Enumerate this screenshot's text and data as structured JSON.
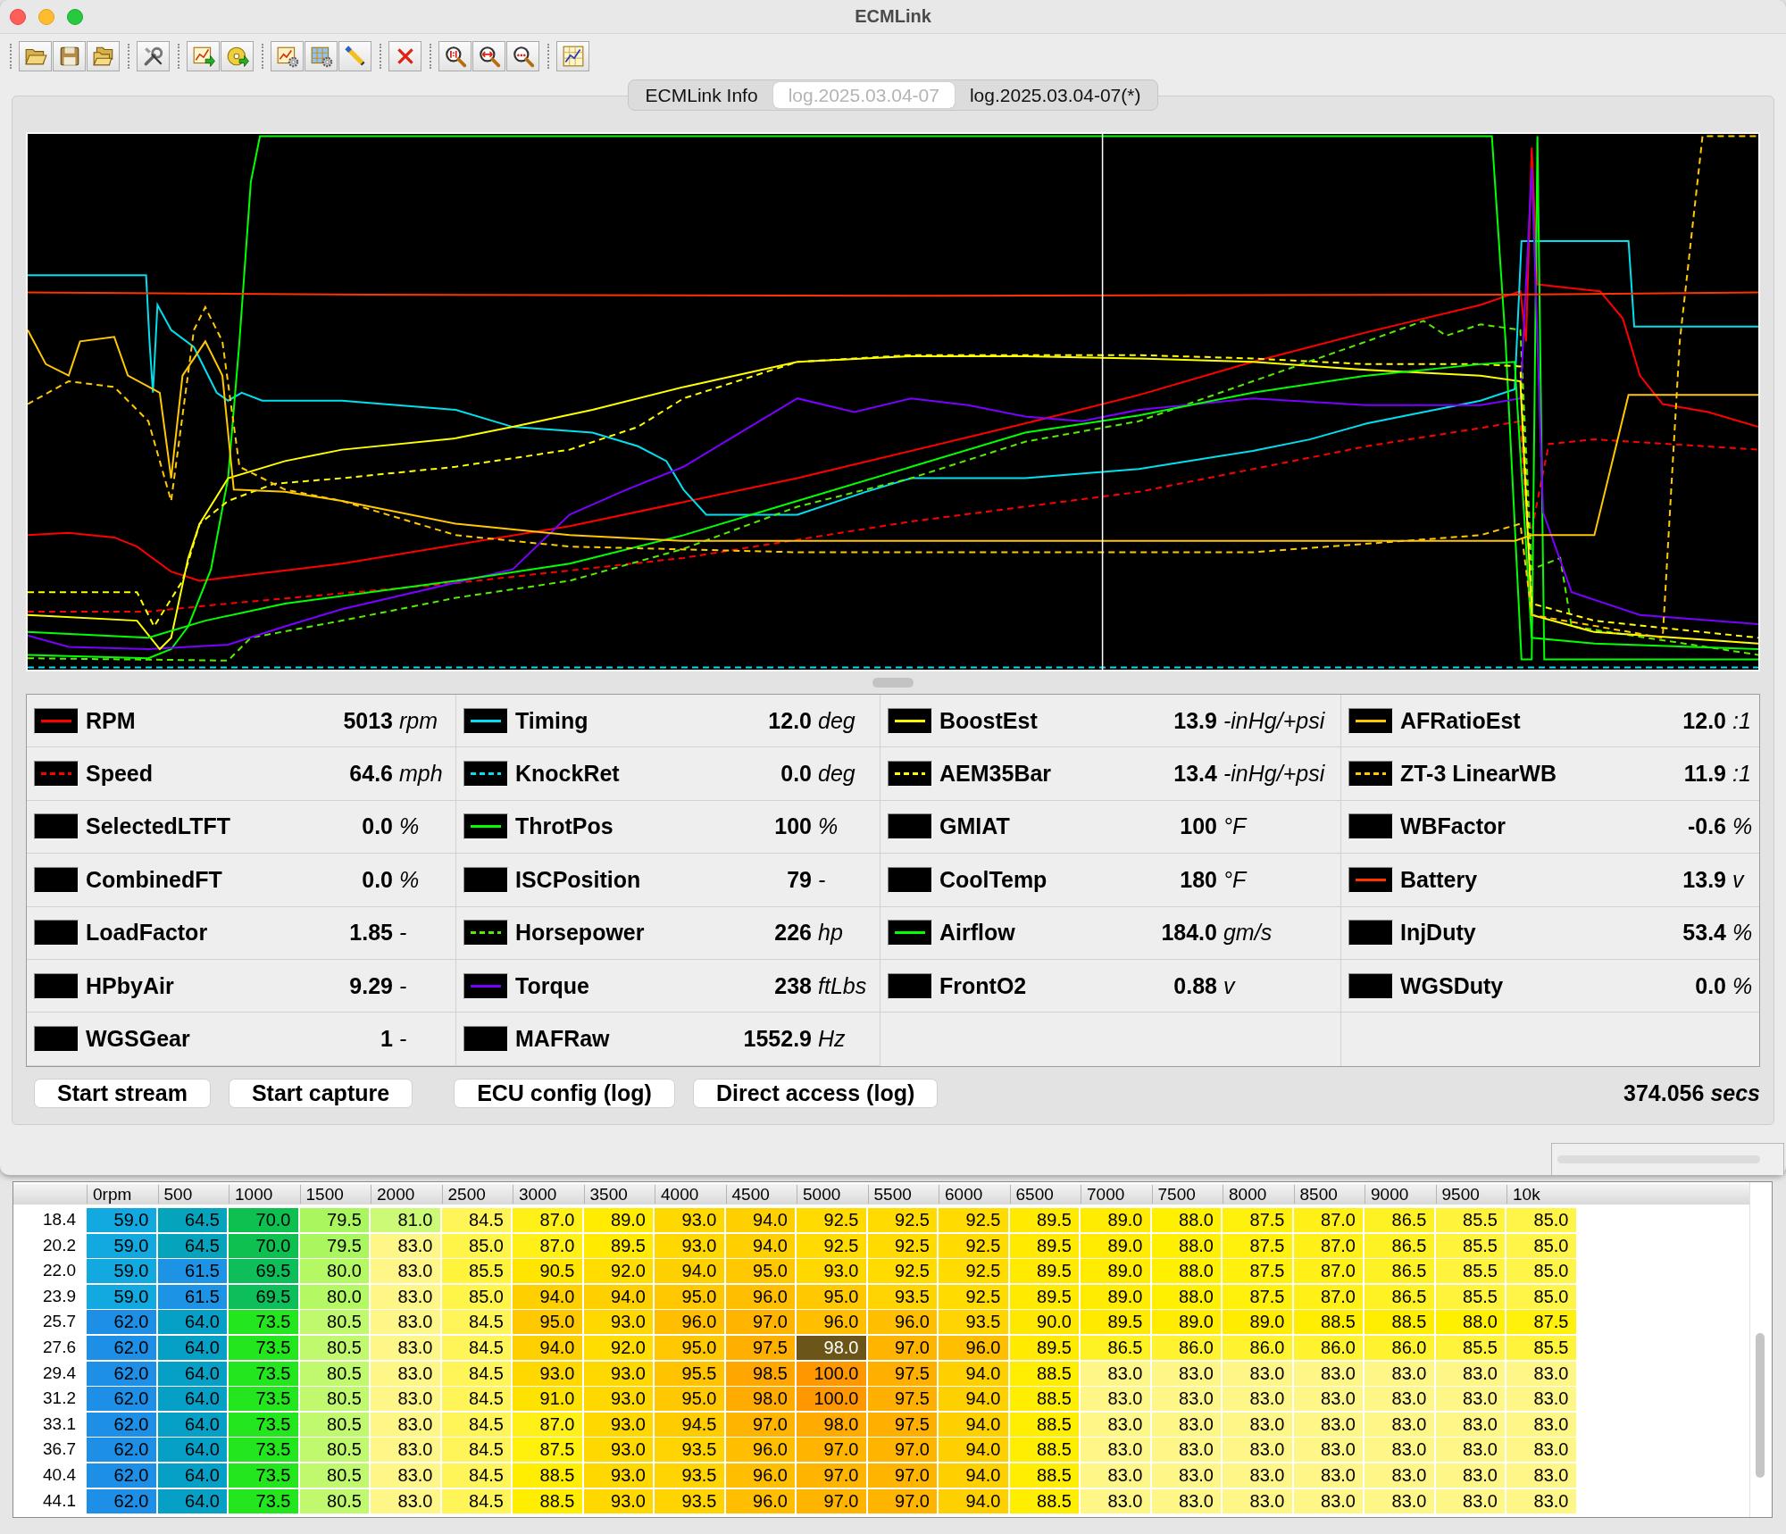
{
  "window": {
    "title": "ECMLink"
  },
  "tabs": [
    {
      "label": "ECMLink Info",
      "selected": false
    },
    {
      "label": "log.2025.03.04-07",
      "selected": true
    },
    {
      "label": "log.2025.03.04-07(*)",
      "selected": false
    }
  ],
  "gauge_columns": [
    {
      "gauges": [
        {
          "name": "RPM",
          "value": "5013",
          "unit": "rpm",
          "kind": "solid",
          "color": "#ff0000"
        },
        {
          "name": "Speed",
          "value": "64.6",
          "unit": "mph",
          "kind": "dashed",
          "color": "#ff0000"
        },
        {
          "name": "SelectedLTFT",
          "value": "0.0",
          "unit": "%",
          "kind": "empty"
        },
        {
          "name": "CombinedFT",
          "value": "0.0",
          "unit": "%",
          "kind": "empty"
        },
        {
          "name": "LoadFactor",
          "value": "1.85",
          "unit": "-",
          "kind": "empty"
        },
        {
          "name": "HPbyAir",
          "value": "9.29",
          "unit": "-",
          "kind": "empty"
        },
        {
          "name": "WGSGear",
          "value": "1",
          "unit": "-",
          "kind": "empty"
        }
      ]
    },
    {
      "gauges": [
        {
          "name": "Timing",
          "value": "12.0",
          "unit": "deg",
          "kind": "solid",
          "color": "#00e0f0"
        },
        {
          "name": "KnockRet",
          "value": "0.0",
          "unit": "deg",
          "kind": "dashed",
          "color": "#00e0f0"
        },
        {
          "name": "ThrotPos",
          "value": "100",
          "unit": "%",
          "kind": "solid",
          "color": "#00ff00"
        },
        {
          "name": "ISCPosition",
          "value": "79",
          "unit": "-",
          "kind": "empty"
        },
        {
          "name": "Horsepower",
          "value": "226",
          "unit": "hp",
          "kind": "dashed",
          "color": "#55ee00"
        },
        {
          "name": "Torque",
          "value": "238",
          "unit": "ftLbs",
          "kind": "solid",
          "color": "#7a00ff"
        },
        {
          "name": "MAFRaw",
          "value": "1552.9",
          "unit": "Hz",
          "kind": "empty"
        }
      ]
    },
    {
      "gauges": [
        {
          "name": "BoostEst",
          "value": "13.9",
          "unit": "-inHg/+psi",
          "kind": "solid",
          "color": "#ffff00"
        },
        {
          "name": "AEM35Bar",
          "value": "13.4",
          "unit": "-inHg/+psi",
          "kind": "dashed",
          "color": "#ffff00"
        },
        {
          "name": "GMIAT",
          "value": "100",
          "unit": "°F",
          "kind": "empty"
        },
        {
          "name": "CoolTemp",
          "value": "180",
          "unit": "°F",
          "kind": "empty"
        },
        {
          "name": "Airflow",
          "value": "184.0",
          "unit": "gm/s",
          "kind": "solid",
          "color": "#00ff00"
        },
        {
          "name": "FrontO2",
          "value": "0.88",
          "unit": "v",
          "kind": "empty"
        }
      ]
    },
    {
      "gauges": [
        {
          "name": "AFRatioEst",
          "value": "12.0",
          "unit": ":1",
          "kind": "solid",
          "color": "#ffc800"
        },
        {
          "name": "ZT-3 LinearWB",
          "value": "11.9",
          "unit": ":1",
          "kind": "dashed",
          "color": "#ffc800"
        },
        {
          "name": "WBFactor",
          "value": "-0.6",
          "unit": "%",
          "kind": "empty"
        },
        {
          "name": "Battery",
          "value": "13.9",
          "unit": "v",
          "kind": "solid",
          "color": "#ff3300"
        },
        {
          "name": "InjDuty",
          "value": "53.4",
          "unit": "%",
          "kind": "empty"
        },
        {
          "name": "WGSDuty",
          "value": "0.0",
          "unit": "%",
          "kind": "empty"
        }
      ]
    }
  ],
  "buttons": [
    "Start stream",
    "Start capture",
    "ECU config (log)",
    "Direct access (log)"
  ],
  "elapsed": {
    "value": "374.056",
    "unit": "secs"
  },
  "table": {
    "columns": [
      "0rpm",
      "500",
      "1000",
      "1500",
      "2000",
      "2500",
      "3000",
      "3500",
      "4000",
      "4500",
      "5000",
      "5500",
      "6000",
      "6500",
      "7000",
      "7500",
      "8000",
      "8500",
      "9000",
      "9500",
      "10k"
    ],
    "rows": [
      {
        "label": "18.4",
        "cells": [
          {
            "value": "59.0",
            "selected": false
          },
          {
            "value": "64.5",
            "selected": false
          },
          {
            "value": "70.0",
            "selected": false
          },
          {
            "value": "79.5",
            "selected": false
          },
          {
            "value": "81.0",
            "selected": false
          },
          {
            "value": "84.5",
            "selected": false
          },
          {
            "value": "87.0",
            "selected": false
          },
          {
            "value": "89.0",
            "selected": false
          },
          {
            "value": "93.0",
            "selected": false
          },
          {
            "value": "94.0",
            "selected": false
          },
          {
            "value": "92.5",
            "selected": false
          },
          {
            "value": "92.5",
            "selected": false
          },
          {
            "value": "92.5",
            "selected": false
          },
          {
            "value": "89.5",
            "selected": false
          },
          {
            "value": "89.0",
            "selected": false
          },
          {
            "value": "88.0",
            "selected": false
          },
          {
            "value": "87.5",
            "selected": false
          },
          {
            "value": "87.0",
            "selected": false
          },
          {
            "value": "86.5",
            "selected": false
          },
          {
            "value": "85.5",
            "selected": false
          },
          {
            "value": "85.0",
            "selected": false
          }
        ]
      },
      {
        "label": "20.2",
        "cells": [
          {
            "value": "59.0",
            "selected": false
          },
          {
            "value": "64.5",
            "selected": false
          },
          {
            "value": "70.0",
            "selected": false
          },
          {
            "value": "79.5",
            "selected": false
          },
          {
            "value": "83.0",
            "selected": false
          },
          {
            "value": "85.0",
            "selected": false
          },
          {
            "value": "87.0",
            "selected": false
          },
          {
            "value": "89.5",
            "selected": false
          },
          {
            "value": "93.0",
            "selected": false
          },
          {
            "value": "94.0",
            "selected": false
          },
          {
            "value": "92.5",
            "selected": false
          },
          {
            "value": "92.5",
            "selected": false
          },
          {
            "value": "92.5",
            "selected": false
          },
          {
            "value": "89.5",
            "selected": false
          },
          {
            "value": "89.0",
            "selected": false
          },
          {
            "value": "88.0",
            "selected": false
          },
          {
            "value": "87.5",
            "selected": false
          },
          {
            "value": "87.0",
            "selected": false
          },
          {
            "value": "86.5",
            "selected": false
          },
          {
            "value": "85.5",
            "selected": false
          },
          {
            "value": "85.0",
            "selected": false
          }
        ]
      },
      {
        "label": "22.0",
        "cells": [
          {
            "value": "59.0",
            "selected": false
          },
          {
            "value": "61.5",
            "selected": false
          },
          {
            "value": "69.5",
            "selected": false
          },
          {
            "value": "80.0",
            "selected": false
          },
          {
            "value": "83.0",
            "selected": false
          },
          {
            "value": "85.5",
            "selected": false
          },
          {
            "value": "90.5",
            "selected": false
          },
          {
            "value": "92.0",
            "selected": false
          },
          {
            "value": "94.0",
            "selected": false
          },
          {
            "value": "95.0",
            "selected": false
          },
          {
            "value": "93.0",
            "selected": false
          },
          {
            "value": "92.5",
            "selected": false
          },
          {
            "value": "92.5",
            "selected": false
          },
          {
            "value": "89.5",
            "selected": false
          },
          {
            "value": "89.0",
            "selected": false
          },
          {
            "value": "88.0",
            "selected": false
          },
          {
            "value": "87.5",
            "selected": false
          },
          {
            "value": "87.0",
            "selected": false
          },
          {
            "value": "86.5",
            "selected": false
          },
          {
            "value": "85.5",
            "selected": false
          },
          {
            "value": "85.0",
            "selected": false
          }
        ]
      },
      {
        "label": "23.9",
        "cells": [
          {
            "value": "59.0",
            "selected": false
          },
          {
            "value": "61.5",
            "selected": false
          },
          {
            "value": "69.5",
            "selected": false
          },
          {
            "value": "80.0",
            "selected": false
          },
          {
            "value": "83.0",
            "selected": false
          },
          {
            "value": "85.0",
            "selected": false
          },
          {
            "value": "94.0",
            "selected": false
          },
          {
            "value": "94.0",
            "selected": false
          },
          {
            "value": "95.0",
            "selected": false
          },
          {
            "value": "96.0",
            "selected": false
          },
          {
            "value": "95.0",
            "selected": false
          },
          {
            "value": "93.5",
            "selected": false
          },
          {
            "value": "92.5",
            "selected": false
          },
          {
            "value": "89.5",
            "selected": false
          },
          {
            "value": "89.0",
            "selected": false
          },
          {
            "value": "88.0",
            "selected": false
          },
          {
            "value": "87.5",
            "selected": false
          },
          {
            "value": "87.0",
            "selected": false
          },
          {
            "value": "86.5",
            "selected": false
          },
          {
            "value": "85.5",
            "selected": false
          },
          {
            "value": "85.0",
            "selected": false
          }
        ]
      },
      {
        "label": "25.7",
        "cells": [
          {
            "value": "62.0",
            "selected": false
          },
          {
            "value": "64.0",
            "selected": false
          },
          {
            "value": "73.5",
            "selected": false
          },
          {
            "value": "80.5",
            "selected": false
          },
          {
            "value": "83.0",
            "selected": false
          },
          {
            "value": "84.5",
            "selected": false
          },
          {
            "value": "95.0",
            "selected": false
          },
          {
            "value": "93.0",
            "selected": false
          },
          {
            "value": "96.0",
            "selected": false
          },
          {
            "value": "97.0",
            "selected": false
          },
          {
            "value": "96.0",
            "selected": false
          },
          {
            "value": "96.0",
            "selected": false
          },
          {
            "value": "93.5",
            "selected": false
          },
          {
            "value": "90.0",
            "selected": false
          },
          {
            "value": "89.5",
            "selected": false
          },
          {
            "value": "89.0",
            "selected": false
          },
          {
            "value": "89.0",
            "selected": false
          },
          {
            "value": "88.5",
            "selected": false
          },
          {
            "value": "88.5",
            "selected": false
          },
          {
            "value": "88.0",
            "selected": false
          },
          {
            "value": "87.5",
            "selected": false
          }
        ]
      },
      {
        "label": "27.6",
        "cells": [
          {
            "value": "62.0",
            "selected": false
          },
          {
            "value": "64.0",
            "selected": false
          },
          {
            "value": "73.5",
            "selected": false
          },
          {
            "value": "80.5",
            "selected": false
          },
          {
            "value": "83.0",
            "selected": false
          },
          {
            "value": "84.5",
            "selected": false
          },
          {
            "value": "94.0",
            "selected": false
          },
          {
            "value": "92.0",
            "selected": false
          },
          {
            "value": "95.0",
            "selected": false
          },
          {
            "value": "97.5",
            "selected": false
          },
          {
            "value": "98.0",
            "selected": true
          },
          {
            "value": "97.0",
            "selected": false
          },
          {
            "value": "96.0",
            "selected": false
          },
          {
            "value": "89.5",
            "selected": false
          },
          {
            "value": "86.5",
            "selected": false
          },
          {
            "value": "86.0",
            "selected": false
          },
          {
            "value": "86.0",
            "selected": false
          },
          {
            "value": "86.0",
            "selected": false
          },
          {
            "value": "86.0",
            "selected": false
          },
          {
            "value": "85.5",
            "selected": false
          },
          {
            "value": "85.5",
            "selected": false
          }
        ]
      },
      {
        "label": "29.4",
        "cells": [
          {
            "value": "62.0",
            "selected": false
          },
          {
            "value": "64.0",
            "selected": false
          },
          {
            "value": "73.5",
            "selected": false
          },
          {
            "value": "80.5",
            "selected": false
          },
          {
            "value": "83.0",
            "selected": false
          },
          {
            "value": "84.5",
            "selected": false
          },
          {
            "value": "93.0",
            "selected": false
          },
          {
            "value": "93.0",
            "selected": false
          },
          {
            "value": "95.5",
            "selected": false
          },
          {
            "value": "98.5",
            "selected": false
          },
          {
            "value": "100.0",
            "selected": false
          },
          {
            "value": "97.5",
            "selected": false
          },
          {
            "value": "94.0",
            "selected": false
          },
          {
            "value": "88.5",
            "selected": false
          },
          {
            "value": "83.0",
            "selected": false
          },
          {
            "value": "83.0",
            "selected": false
          },
          {
            "value": "83.0",
            "selected": false
          },
          {
            "value": "83.0",
            "selected": false
          },
          {
            "value": "83.0",
            "selected": false
          },
          {
            "value": "83.0",
            "selected": false
          },
          {
            "value": "83.0",
            "selected": false
          }
        ]
      },
      {
        "label": "31.2",
        "cells": [
          {
            "value": "62.0",
            "selected": false
          },
          {
            "value": "64.0",
            "selected": false
          },
          {
            "value": "73.5",
            "selected": false
          },
          {
            "value": "80.5",
            "selected": false
          },
          {
            "value": "83.0",
            "selected": false
          },
          {
            "value": "84.5",
            "selected": false
          },
          {
            "value": "91.0",
            "selected": false
          },
          {
            "value": "93.0",
            "selected": false
          },
          {
            "value": "95.0",
            "selected": false
          },
          {
            "value": "98.0",
            "selected": false
          },
          {
            "value": "100.0",
            "selected": false
          },
          {
            "value": "97.5",
            "selected": false
          },
          {
            "value": "94.0",
            "selected": false
          },
          {
            "value": "88.5",
            "selected": false
          },
          {
            "value": "83.0",
            "selected": false
          },
          {
            "value": "83.0",
            "selected": false
          },
          {
            "value": "83.0",
            "selected": false
          },
          {
            "value": "83.0",
            "selected": false
          },
          {
            "value": "83.0",
            "selected": false
          },
          {
            "value": "83.0",
            "selected": false
          },
          {
            "value": "83.0",
            "selected": false
          }
        ]
      },
      {
        "label": "33.1",
        "cells": [
          {
            "value": "62.0",
            "selected": false
          },
          {
            "value": "64.0",
            "selected": false
          },
          {
            "value": "73.5",
            "selected": false
          },
          {
            "value": "80.5",
            "selected": false
          },
          {
            "value": "83.0",
            "selected": false
          },
          {
            "value": "84.5",
            "selected": false
          },
          {
            "value": "87.0",
            "selected": false
          },
          {
            "value": "93.0",
            "selected": false
          },
          {
            "value": "94.5",
            "selected": false
          },
          {
            "value": "97.0",
            "selected": false
          },
          {
            "value": "98.0",
            "selected": false
          },
          {
            "value": "97.5",
            "selected": false
          },
          {
            "value": "94.0",
            "selected": false
          },
          {
            "value": "88.5",
            "selected": false
          },
          {
            "value": "83.0",
            "selected": false
          },
          {
            "value": "83.0",
            "selected": false
          },
          {
            "value": "83.0",
            "selected": false
          },
          {
            "value": "83.0",
            "selected": false
          },
          {
            "value": "83.0",
            "selected": false
          },
          {
            "value": "83.0",
            "selected": false
          },
          {
            "value": "83.0",
            "selected": false
          }
        ]
      },
      {
        "label": "36.7",
        "cells": [
          {
            "value": "62.0",
            "selected": false
          },
          {
            "value": "64.0",
            "selected": false
          },
          {
            "value": "73.5",
            "selected": false
          },
          {
            "value": "80.5",
            "selected": false
          },
          {
            "value": "83.0",
            "selected": false
          },
          {
            "value": "84.5",
            "selected": false
          },
          {
            "value": "87.5",
            "selected": false
          },
          {
            "value": "93.0",
            "selected": false
          },
          {
            "value": "93.5",
            "selected": false
          },
          {
            "value": "96.0",
            "selected": false
          },
          {
            "value": "97.0",
            "selected": false
          },
          {
            "value": "97.0",
            "selected": false
          },
          {
            "value": "94.0",
            "selected": false
          },
          {
            "value": "88.5",
            "selected": false
          },
          {
            "value": "83.0",
            "selected": false
          },
          {
            "value": "83.0",
            "selected": false
          },
          {
            "value": "83.0",
            "selected": false
          },
          {
            "value": "83.0",
            "selected": false
          },
          {
            "value": "83.0",
            "selected": false
          },
          {
            "value": "83.0",
            "selected": false
          },
          {
            "value": "83.0",
            "selected": false
          }
        ]
      },
      {
        "label": "40.4",
        "cells": [
          {
            "value": "62.0",
            "selected": false
          },
          {
            "value": "64.0",
            "selected": false
          },
          {
            "value": "73.5",
            "selected": false
          },
          {
            "value": "80.5",
            "selected": false
          },
          {
            "value": "83.0",
            "selected": false
          },
          {
            "value": "84.5",
            "selected": false
          },
          {
            "value": "88.5",
            "selected": false
          },
          {
            "value": "93.0",
            "selected": false
          },
          {
            "value": "93.5",
            "selected": false
          },
          {
            "value": "96.0",
            "selected": false
          },
          {
            "value": "97.0",
            "selected": false
          },
          {
            "value": "97.0",
            "selected": false
          },
          {
            "value": "94.0",
            "selected": false
          },
          {
            "value": "88.5",
            "selected": false
          },
          {
            "value": "83.0",
            "selected": false
          },
          {
            "value": "83.0",
            "selected": false
          },
          {
            "value": "83.0",
            "selected": false
          },
          {
            "value": "83.0",
            "selected": false
          },
          {
            "value": "83.0",
            "selected": false
          },
          {
            "value": "83.0",
            "selected": false
          },
          {
            "value": "83.0",
            "selected": false
          }
        ]
      },
      {
        "label": "44.1",
        "cells": [
          {
            "value": "62.0",
            "selected": false
          },
          {
            "value": "64.0",
            "selected": false
          },
          {
            "value": "73.5",
            "selected": false
          },
          {
            "value": "80.5",
            "selected": false
          },
          {
            "value": "83.0",
            "selected": false
          },
          {
            "value": "84.5",
            "selected": false
          },
          {
            "value": "88.5",
            "selected": false
          },
          {
            "value": "93.0",
            "selected": false
          },
          {
            "value": "93.5",
            "selected": false
          },
          {
            "value": "96.0",
            "selected": false
          },
          {
            "value": "97.0",
            "selected": false
          },
          {
            "value": "97.0",
            "selected": false
          },
          {
            "value": "94.0",
            "selected": false
          },
          {
            "value": "88.5",
            "selected": false
          },
          {
            "value": "83.0",
            "selected": false
          },
          {
            "value": "83.0",
            "selected": false
          },
          {
            "value": "83.0",
            "selected": false
          },
          {
            "value": "83.0",
            "selected": false
          },
          {
            "value": "83.0",
            "selected": false
          },
          {
            "value": "83.0",
            "selected": false
          },
          {
            "value": "83.0",
            "selected": false
          }
        ]
      }
    ]
  }
}
